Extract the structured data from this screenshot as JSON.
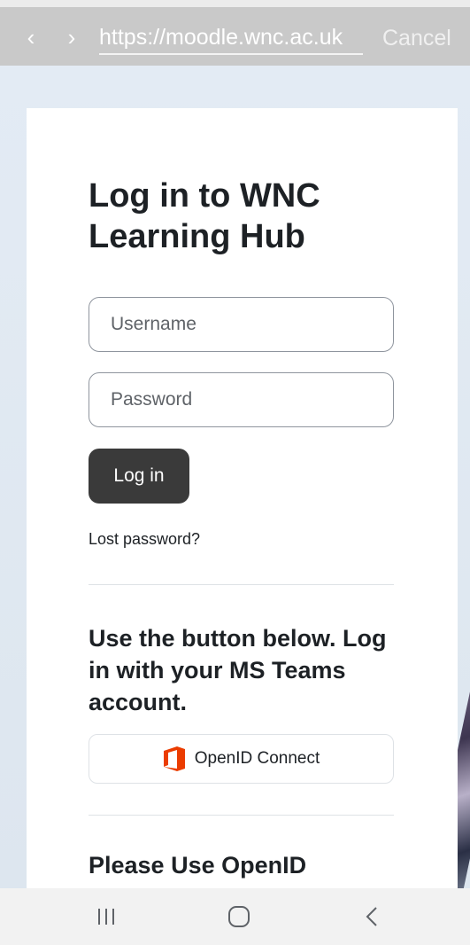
{
  "browser": {
    "back_icon": "chevron-left-icon",
    "forward_icon": "chevron-right-icon",
    "url": "https://moodle.wnc.ac.uk",
    "cancel_label": "Cancel"
  },
  "login": {
    "title": "Log in to WNC Learning Hub",
    "username_placeholder": "Username",
    "username_value": "",
    "password_placeholder": "Password",
    "password_value": "",
    "login_label": "Log in",
    "lost_password_label": "Lost password?",
    "openid_heading": "Use the button below. Log in with your MS Teams account.",
    "openid_button_label": "OpenID Connect",
    "openid_icon": "office-icon",
    "openid_heading_2": "Please Use OpenID"
  },
  "colors": {
    "login_button": "#3a3a3a",
    "office_icon": "#eb3c00"
  },
  "system_nav": {
    "recent_icon": "recent-apps-icon",
    "home_icon": "home-icon",
    "back_icon": "back-icon"
  }
}
